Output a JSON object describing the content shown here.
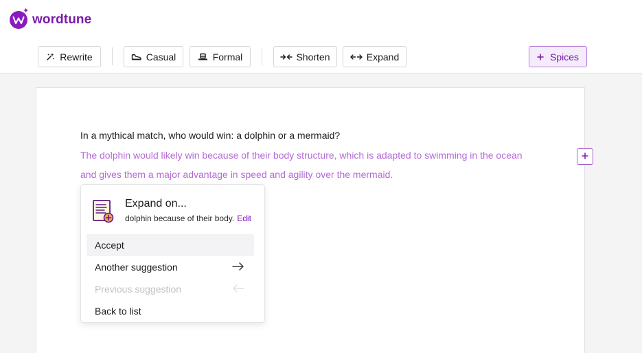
{
  "app": {
    "name": "wordtune"
  },
  "toolbar": {
    "rewrite": "Rewrite",
    "casual": "Casual",
    "formal": "Formal",
    "shorten": "Shorten",
    "expand": "Expand",
    "spices": "Spices"
  },
  "editor": {
    "question": "In a mythical match, who would win: a dolphin or a mermaid?",
    "answer": "The dolphin would likely win because of their body structure, which is adapted to swimming in the ocean and gives them a major advantage in speed and agility over the mermaid."
  },
  "popup": {
    "title": "Expand on...",
    "subtitle": "dolphin because of their body.",
    "edit_label": "Edit",
    "items": [
      {
        "label": "Accept"
      },
      {
        "label": "Another suggestion"
      },
      {
        "label": "Previous suggestion"
      },
      {
        "label": "Back to list"
      }
    ]
  },
  "colors": {
    "brand": "#8a1bbf",
    "suggestion_text": "#b46ad6",
    "spices_bg": "#f5ecfb"
  },
  "icons": {
    "logo": "wordtune-logo-icon",
    "rewrite": "sparkle-icon",
    "casual": "sneaker-icon",
    "formal": "hat-icon",
    "shorten": "shorten-arrows-icon",
    "expand": "expand-arrows-icon",
    "spices": "plus-icon",
    "popup": "document-plus-icon"
  }
}
